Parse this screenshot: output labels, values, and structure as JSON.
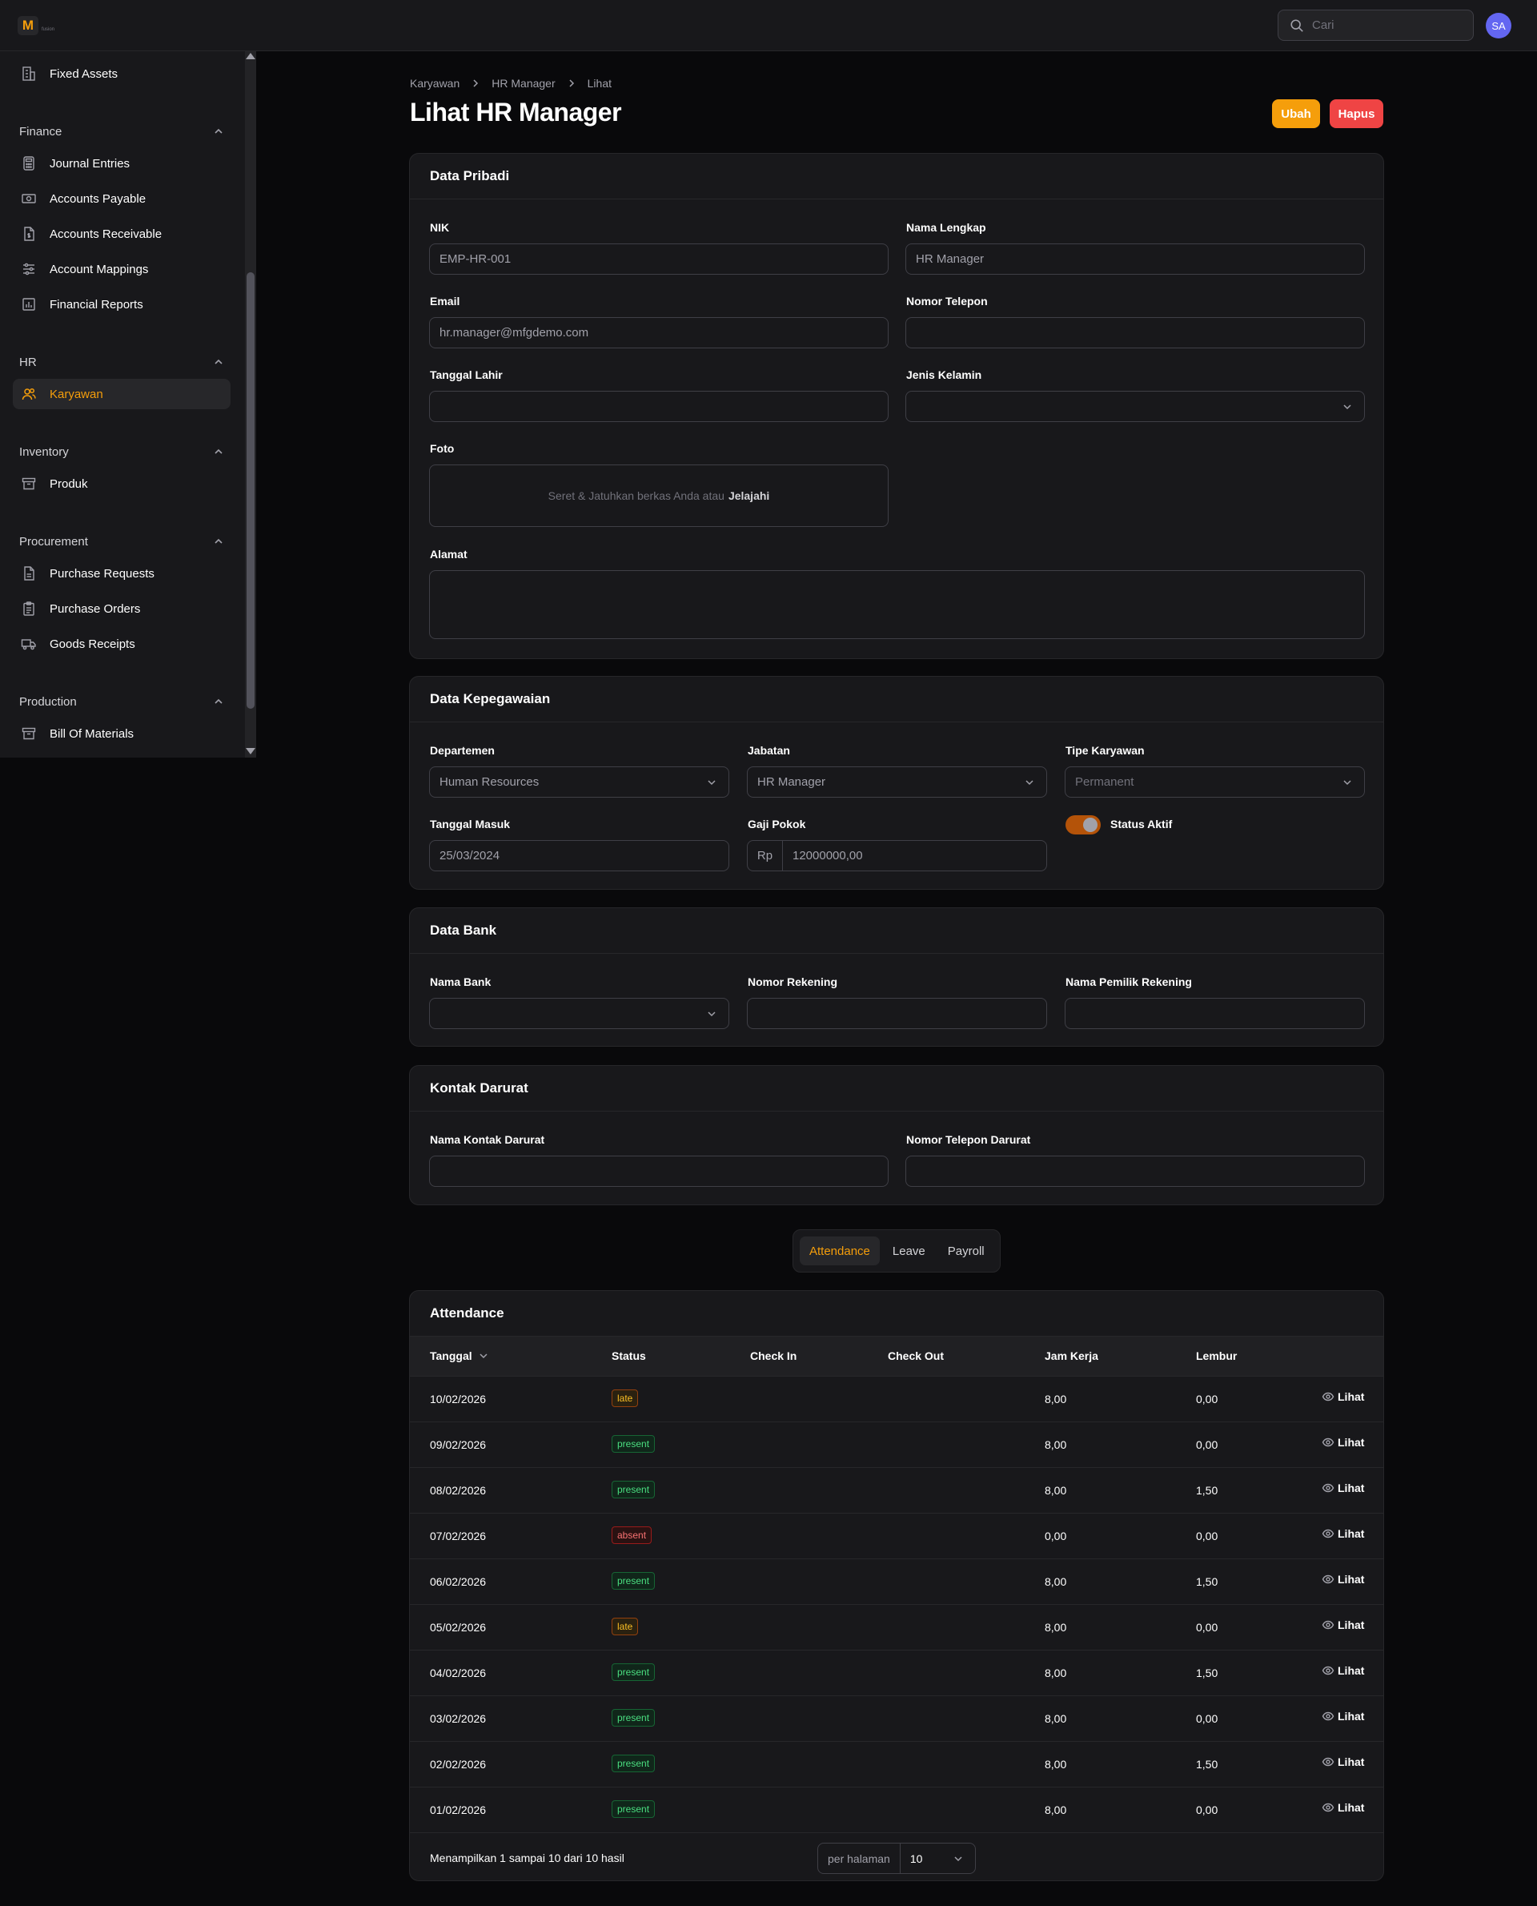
{
  "header": {
    "logo_letter": "M",
    "logo_sub": "fusion",
    "search_placeholder": "Cari",
    "avatar_initials": "SA"
  },
  "sidebar": {
    "top_item": "Fixed Assets",
    "groups": [
      {
        "label": "Finance",
        "items": [
          "Journal Entries",
          "Accounts Payable",
          "Accounts Receivable",
          "Account Mappings",
          "Financial Reports"
        ]
      },
      {
        "label": "HR",
        "items": [
          "Karyawan"
        ]
      },
      {
        "label": "Inventory",
        "items": [
          "Produk"
        ]
      },
      {
        "label": "Procurement",
        "items": [
          "Purchase Requests",
          "Purchase Orders",
          "Goods Receipts"
        ]
      },
      {
        "label": "Production",
        "items": [
          "Bill Of Materials"
        ]
      }
    ],
    "active_item": "Karyawan"
  },
  "breadcrumb": [
    "Karyawan",
    "HR Manager",
    "Lihat"
  ],
  "page": {
    "title": "Lihat HR Manager",
    "edit_label": "Ubah",
    "delete_label": "Hapus"
  },
  "personal": {
    "heading": "Data Pribadi",
    "nik_label": "NIK",
    "nik_value": "EMP-HR-001",
    "name_label": "Nama Lengkap",
    "name_value": "HR Manager",
    "email_label": "Email",
    "email_value": "hr.manager@mfgdemo.com",
    "phone_label": "Nomor Telepon",
    "phone_value": "",
    "birth_label": "Tanggal Lahir",
    "birth_value": "",
    "gender_label": "Jenis Kelamin",
    "gender_value": "",
    "photo_label": "Foto",
    "upload_text": "Seret & Jatuhkan berkas Anda atau",
    "upload_link": "Jelajahi",
    "address_label": "Alamat"
  },
  "employment": {
    "heading": "Data Kepegawaian",
    "dept_label": "Departemen",
    "dept_value": "Human Resources",
    "position_label": "Jabatan",
    "position_value": "HR Manager",
    "type_label": "Tipe Karyawan",
    "type_value": "Permanent",
    "join_label": "Tanggal Masuk",
    "join_value": "25/03/2024",
    "salary_label": "Gaji Pokok",
    "salary_prefix": "Rp",
    "salary_value": "12000000,00",
    "active_label": "Status Aktif",
    "active_on": true
  },
  "bank": {
    "heading": "Data Bank",
    "bank_label": "Nama Bank",
    "account_label": "Nomor Rekening",
    "owner_label": "Nama Pemilik Rekening"
  },
  "emergency": {
    "heading": "Kontak Darurat",
    "name_label": "Nama Kontak Darurat",
    "phone_label": "Nomor Telepon Darurat"
  },
  "tabs": [
    {
      "label": "Attendance",
      "active": true
    },
    {
      "label": "Leave",
      "active": false
    },
    {
      "label": "Payroll",
      "active": false
    }
  ],
  "attendance": {
    "heading": "Attendance",
    "columns": [
      "Tanggal",
      "Status",
      "Check In",
      "Check Out",
      "Jam Kerja",
      "Lembur"
    ],
    "view_label": "Lihat",
    "rows": [
      {
        "date": "10/02/2026",
        "status": "late",
        "hours": "8,00",
        "overtime": "0,00"
      },
      {
        "date": "09/02/2026",
        "status": "present",
        "hours": "8,00",
        "overtime": "0,00"
      },
      {
        "date": "08/02/2026",
        "status": "present",
        "hours": "8,00",
        "overtime": "1,50"
      },
      {
        "date": "07/02/2026",
        "status": "absent",
        "hours": "0,00",
        "overtime": "0,00"
      },
      {
        "date": "06/02/2026",
        "status": "present",
        "hours": "8,00",
        "overtime": "1,50"
      },
      {
        "date": "05/02/2026",
        "status": "late",
        "hours": "8,00",
        "overtime": "0,00"
      },
      {
        "date": "04/02/2026",
        "status": "present",
        "hours": "8,00",
        "overtime": "1,50"
      },
      {
        "date": "03/02/2026",
        "status": "present",
        "hours": "8,00",
        "overtime": "0,00"
      },
      {
        "date": "02/02/2026",
        "status": "present",
        "hours": "8,00",
        "overtime": "1,50"
      },
      {
        "date": "01/02/2026",
        "status": "present",
        "hours": "8,00",
        "overtime": "0,00"
      }
    ],
    "summary": "Menampilkan 1 sampai 10 dari 10 hasil",
    "per_page_label": "per halaman",
    "per_page_value": "10"
  },
  "colors": {
    "accent": "#f59e0b",
    "danger": "#ef4444",
    "avatar": "#6366f1"
  }
}
